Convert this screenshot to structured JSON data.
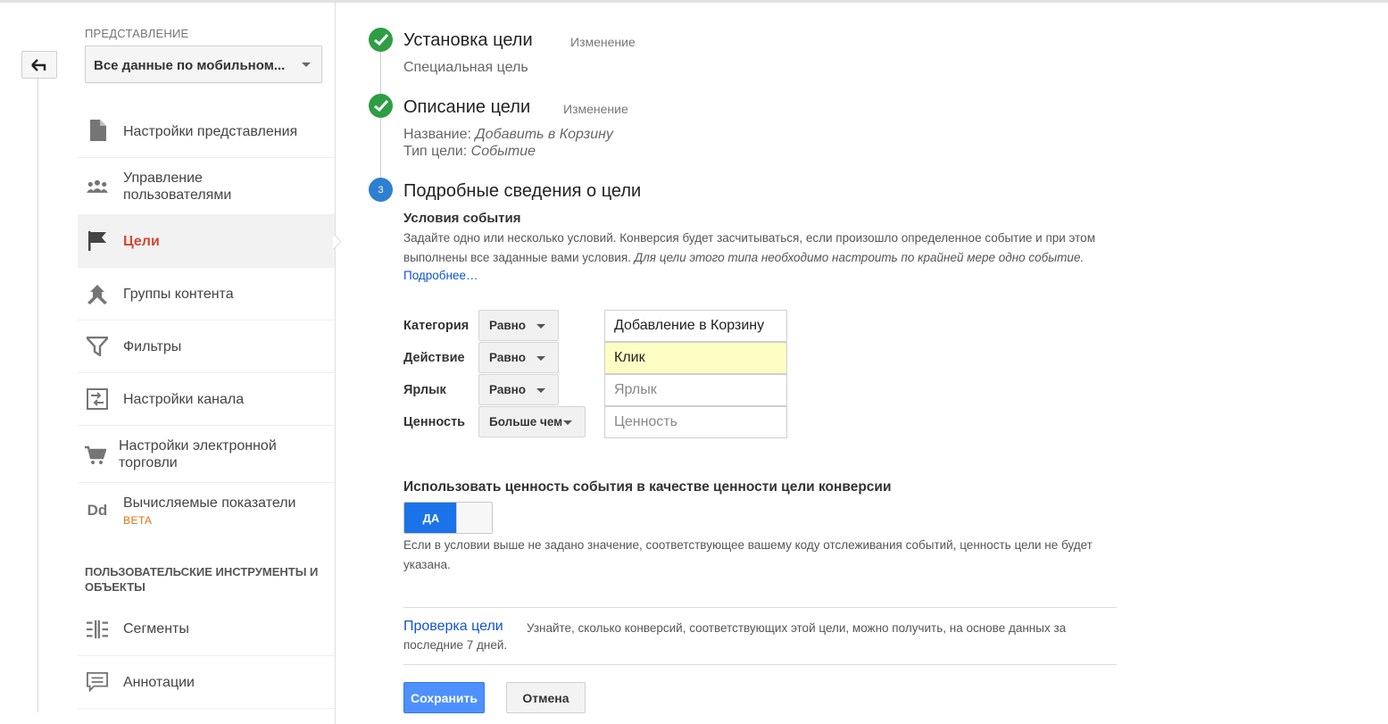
{
  "left_rail": {
    "back_icon": "back-arrow-icon"
  },
  "sidebar": {
    "view_label": "ПРЕДСТАВЛЕНИЕ",
    "view_select_value": "Все данные по мобильном...",
    "items": [
      {
        "label": "Настройки представления",
        "icon": "document-icon"
      },
      {
        "label": "Управление пользователями",
        "icon": "users-icon"
      },
      {
        "label": "Цели",
        "icon": "flag-icon",
        "active": true
      },
      {
        "label": "Группы контента",
        "icon": "content-group-icon"
      },
      {
        "label": "Фильтры",
        "icon": "filter-icon"
      },
      {
        "label": "Настройки канала",
        "icon": "channel-settings-icon"
      },
      {
        "label": "Настройки электронной торговли",
        "icon": "cart-icon"
      },
      {
        "label": "Вычисляемые показатели",
        "icon": "dd-icon",
        "icon_text": "Dd",
        "badge": "BETA"
      }
    ],
    "section_header": "ПОЛЬЗОВАТЕЛЬСКИЕ ИНСТРУМЕНТЫ И ОБЪЕКТЫ",
    "tools": [
      {
        "label": "Сегменты",
        "icon": "segments-icon"
      },
      {
        "label": "Аннотации",
        "icon": "annotations-icon"
      }
    ],
    "active_color": "#d14836"
  },
  "steps": {
    "step1": {
      "title": "Установка цели",
      "edit": "Изменение",
      "summary": "Специальная цель"
    },
    "step2": {
      "title": "Описание цели",
      "edit": "Изменение",
      "name_label": "Название:",
      "name_value": "Добавить в Корзину",
      "type_label": "Тип цели:",
      "type_value": "Событие"
    },
    "step3": {
      "number": "3",
      "title": "Подробные сведения о цели"
    }
  },
  "conditions": {
    "title": "Условия события",
    "desc": "Задайте одно или несколько условий. Конверсия будет засчитываться, если произошло определенное событие и при этом выполнены все заданные вами условия.",
    "desc_italic": "Для цели этого типа необходимо настроить по крайней мере одно событие.",
    "more": "Подробнее…",
    "rows": [
      {
        "label": "Категория",
        "operator": "Равно",
        "value": "Добавление в Корзину",
        "placeholder": ""
      },
      {
        "label": "Действие",
        "operator": "Равно",
        "value": "Клик",
        "placeholder": ""
      },
      {
        "label": "Ярлык",
        "operator": "Равно",
        "value": "",
        "placeholder": "Ярлык"
      },
      {
        "label": "Ценность",
        "operator": "Больше чем",
        "value": "",
        "placeholder": "Ценность"
      }
    ]
  },
  "use_value": {
    "title": "Использовать ценность события в качестве ценности цели конверсии",
    "toggle_label": "ДА",
    "note": "Если в условии выше не задано значение, соответствующее вашему коду отслеживания событий, ценность цели не будет указана."
  },
  "verify": {
    "link": "Проверка цели",
    "desc": "Узнайте, сколько конверсий, соответствующих этой цели, можно получить, на основе данных за последние 7 дней."
  },
  "buttons": {
    "save": "Сохранить",
    "cancel": "Отмена"
  },
  "colors": {
    "check": "#2e9e44",
    "step_active": "#2d7fd0",
    "primary": "#4d90fe",
    "link": "#1155cc",
    "highlight": "#fdfdc4"
  }
}
